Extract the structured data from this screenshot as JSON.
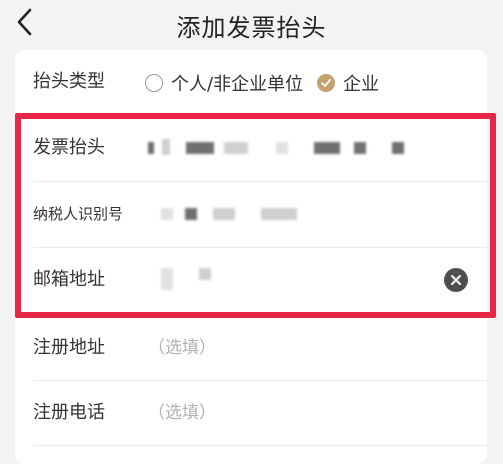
{
  "header": {
    "title": "添加发票抬头"
  },
  "form": {
    "title_type": {
      "label": "抬头类型",
      "options": [
        {
          "label": "个人/非企业单位",
          "selected": false
        },
        {
          "label": "企业",
          "selected": true
        }
      ]
    },
    "invoice_title": {
      "label": "发票抬头"
    },
    "tax_id": {
      "label": "纳税人识别号"
    },
    "email": {
      "label": "邮箱地址"
    },
    "reg_address": {
      "label": "注册地址",
      "placeholder": "（选填）"
    },
    "reg_phone": {
      "label": "注册电话",
      "placeholder": "（选填）"
    }
  },
  "colors": {
    "accent": "#c2a16e",
    "highlight_border": "#e8264a",
    "background": "#f3f3f3"
  }
}
